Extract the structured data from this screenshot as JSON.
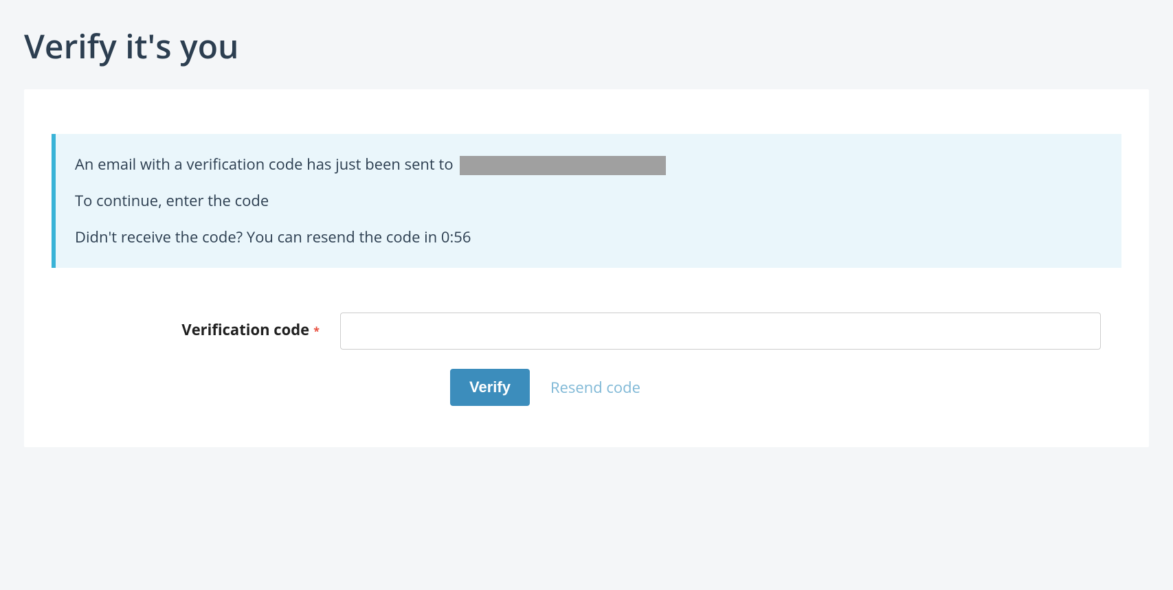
{
  "page": {
    "title": "Verify it's you"
  },
  "info": {
    "line1_prefix": "An email with a verification code has just been sent to ",
    "line2": "To continue, enter the code",
    "line3": "Didn't receive the code? You can resend the code in 0:56"
  },
  "form": {
    "label": "Verification code",
    "required_marker": "*",
    "input_value": ""
  },
  "actions": {
    "verify_label": "Verify",
    "resend_label": "Resend code"
  },
  "colors": {
    "accent": "#3c8dbc",
    "info_border": "#39b3d7",
    "info_bg": "#eaf6fb",
    "required": "#e74c3c"
  }
}
